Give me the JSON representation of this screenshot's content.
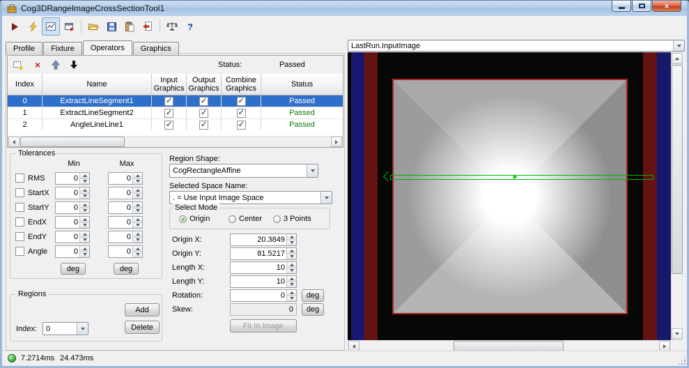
{
  "window": {
    "title": "Cog3DRangeImageCrossSectionTool1"
  },
  "icons": {
    "close": "×",
    "help": "?",
    "delete_operator": "×"
  },
  "tabs": [
    "Profile",
    "Fixture",
    "Operators",
    "Graphics"
  ],
  "operators": {
    "status_label": "Status:",
    "status_value": "Passed",
    "selected_row": 0,
    "columns": {
      "index": "Index",
      "name": "Name",
      "input": "Input Graphics",
      "output": "Output Graphics",
      "combine": "Combine Graphics",
      "status": "Status"
    },
    "rows": [
      {
        "index": "0",
        "name": "ExtractLineSegment1",
        "input": true,
        "output": true,
        "combine": true,
        "status": "Passed"
      },
      {
        "index": "1",
        "name": "ExtractLineSegment2",
        "input": true,
        "output": true,
        "combine": true,
        "status": "Passed"
      },
      {
        "index": "2",
        "name": "AngleLineLine1",
        "input": true,
        "output": true,
        "combine": true,
        "status": "Passed"
      }
    ]
  },
  "tolerances": {
    "title": "Tolerances",
    "min": "Min",
    "max": "Max",
    "rows": [
      "RMS",
      "StartX",
      "StartY",
      "EndX",
      "EndY",
      "Angle"
    ],
    "checked": false,
    "value": "0",
    "deg": "deg"
  },
  "region": {
    "shape_label": "Region Shape:",
    "shape_value": "CogRectangleAffine",
    "space_label": "Selected Space Name:",
    "space_value": ". = Use Input Image Space",
    "mode_label": "Select Mode",
    "modes": [
      "Origin",
      "Center",
      "3 Points"
    ],
    "selected_mode": "Origin",
    "origin_x_label": "Origin X:",
    "origin_x": "20.3849",
    "origin_y_label": "Origin Y:",
    "origin_y": "81.5217",
    "length_x_label": "Length X:",
    "length_x": "10",
    "length_y_label": "Length Y:",
    "length_y": "10",
    "rotation_label": "Rotation:",
    "rotation": "0",
    "skew_label": "Skew:",
    "skew": "0",
    "deg": "deg",
    "fit_button": "Fit In Image"
  },
  "regions": {
    "title": "Regions",
    "add": "Add",
    "index_label": "Index:",
    "index_value": "0",
    "delete": "Delete"
  },
  "display": {
    "selector": "LastRun.InputImage"
  },
  "statusbar": {
    "time1": "7.2714ms",
    "time2": "24.473ms"
  }
}
